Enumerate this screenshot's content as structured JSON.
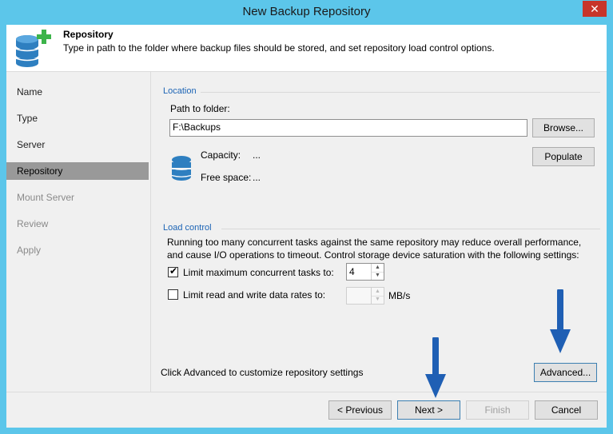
{
  "window": {
    "title": "New Backup Repository",
    "close_glyph": "✕"
  },
  "header": {
    "title": "Repository",
    "description": "Type in path to the folder where backup files should be stored, and set repository load control options.",
    "icon": "database-add-icon"
  },
  "steps": [
    {
      "label": "Name",
      "state": "normal"
    },
    {
      "label": "Type",
      "state": "normal"
    },
    {
      "label": "Server",
      "state": "normal"
    },
    {
      "label": "Repository",
      "state": "active"
    },
    {
      "label": "Mount Server",
      "state": "disabled"
    },
    {
      "label": "Review",
      "state": "disabled"
    },
    {
      "label": "Apply",
      "state": "disabled"
    }
  ],
  "location": {
    "group_label": "Location",
    "path_label": "Path to folder:",
    "path_value": "F:\\Backups",
    "browse_label": "Browse...",
    "populate_label": "Populate",
    "capacity_label": "Capacity:",
    "capacity_value": "...",
    "free_label": "Free space:",
    "free_value": "...",
    "icon": "database-icon"
  },
  "load_control": {
    "group_label": "Load control",
    "description_line1": "Running too many concurrent tasks against the same repository may reduce overall performance,",
    "description_line2": "and cause I/O operations to timeout. Control storage device saturation with the following settings:",
    "limit_tasks_label": "Limit maximum concurrent tasks to:",
    "limit_tasks_checked": true,
    "limit_tasks_value": "4",
    "limit_rate_label": "Limit read and write data rates to:",
    "limit_rate_checked": false,
    "limit_rate_value": "",
    "rate_unit": "MB/s"
  },
  "advanced": {
    "hint": "Click Advanced to customize repository settings",
    "button_label": "Advanced..."
  },
  "footer": {
    "previous_label": "< Previous",
    "next_label": "Next >",
    "finish_label": "Finish",
    "cancel_label": "Cancel"
  },
  "colors": {
    "title_bar": "#5cc6ea",
    "accent_group": "#1c64b5",
    "annotation_arrow": "#1f5fb4",
    "icon_green": "#3cb44a",
    "icon_blue": "#2e7fc0"
  }
}
